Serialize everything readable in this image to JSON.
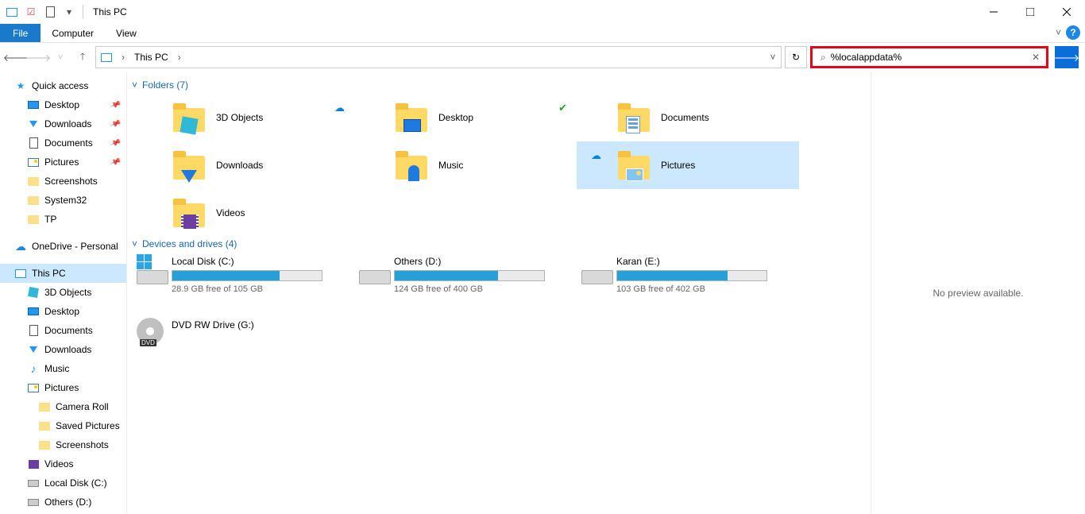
{
  "window": {
    "title": "This PC"
  },
  "menu": {
    "file": "File",
    "home": "Computer",
    "view": "View"
  },
  "nav": {
    "location": "This PC",
    "search_value": "%localappdata%"
  },
  "sidebar": {
    "quick": "Quick access",
    "desktop": "Desktop",
    "downloads": "Downloads",
    "documents": "Documents",
    "pictures": "Pictures",
    "screenshots": "Screenshots",
    "system32": "System32",
    "tp": "TP",
    "onedrive": "OneDrive - Personal",
    "thispc": "This PC",
    "objects3d": "3D Objects",
    "desktop2": "Desktop",
    "documents2": "Documents",
    "downloads2": "Downloads",
    "music": "Music",
    "pictures2": "Pictures",
    "cameraroll": "Camera Roll",
    "savedpictures": "Saved Pictures",
    "screenshots2": "Screenshots",
    "videos": "Videos",
    "localdiskc": "Local Disk (C:)",
    "othersd": "Others (D:)"
  },
  "sections": {
    "folders": "Folders (7)",
    "drives": "Devices and drives (4)"
  },
  "folders": {
    "f1": "3D Objects",
    "f2": "Desktop",
    "f3": "Documents",
    "f4": "Downloads",
    "f5": "Music",
    "f6": "Pictures",
    "f7": "Videos"
  },
  "drives": {
    "d1": {
      "name": "Local Disk (C:)",
      "free": "28.9 GB free of 105 GB",
      "pct": 72
    },
    "d2": {
      "name": "Others (D:)",
      "free": "124 GB free of 400 GB",
      "pct": 69
    },
    "d3": {
      "name": "Karan (E:)",
      "free": "103 GB free of 402 GB",
      "pct": 74
    },
    "d4": {
      "name": "DVD RW Drive (G:)"
    }
  },
  "preview": {
    "msg": "No preview available."
  }
}
